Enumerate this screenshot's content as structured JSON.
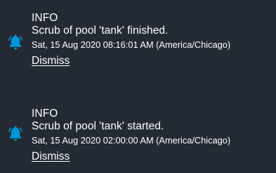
{
  "notifications": [
    {
      "icon": "bell-icon",
      "icon_color": "#0095d5",
      "level": "INFO",
      "message": "Scrub of pool 'tank' finished.",
      "timestamp": "Sat, 15 Aug 2020 08:16:01 AM (America/Chicago)",
      "dismiss_label": "Dismiss"
    },
    {
      "icon": "bell-icon",
      "icon_color": "#0095d5",
      "level": "INFO",
      "message": "Scrub of pool 'tank' started.",
      "timestamp": "Sat, 15 Aug 2020 02:00:00 AM (America/Chicago)",
      "dismiss_label": "Dismiss"
    }
  ],
  "colors": {
    "background": "#232a33",
    "text": "#ffffff",
    "accent": "#0095d5"
  }
}
